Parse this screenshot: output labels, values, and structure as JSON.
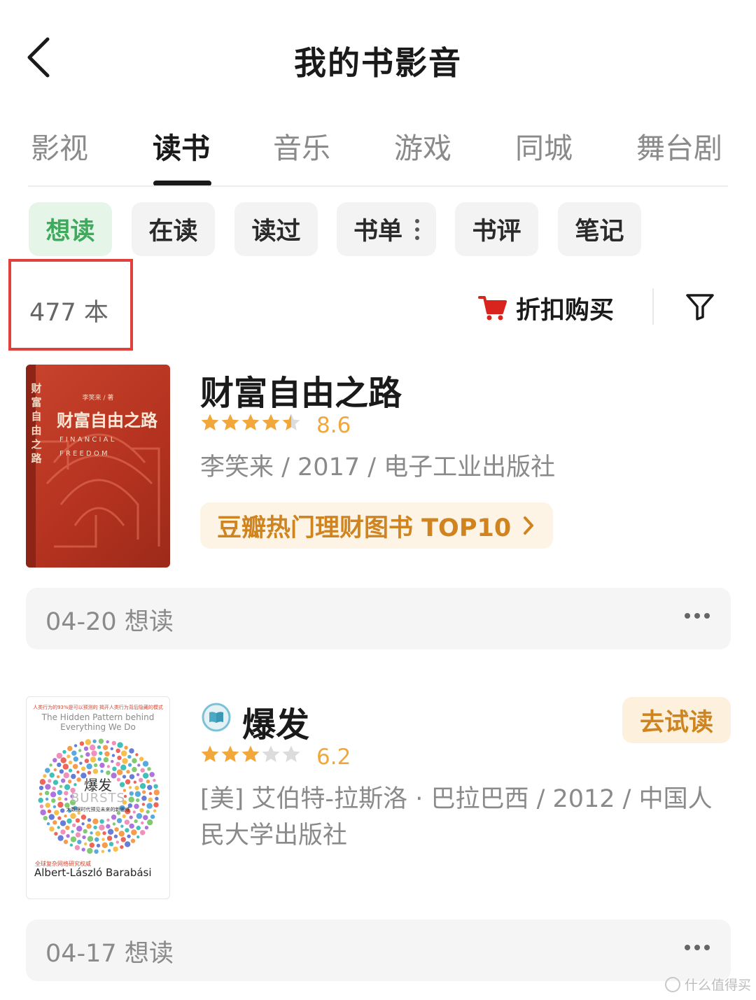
{
  "header": {
    "title": "我的书影音"
  },
  "tabs": [
    {
      "label": "影视"
    },
    {
      "label": "读书"
    },
    {
      "label": "音乐"
    },
    {
      "label": "游戏"
    },
    {
      "label": "同城"
    },
    {
      "label": "舞台剧"
    }
  ],
  "chips": [
    {
      "label": "想读"
    },
    {
      "label": "在读"
    },
    {
      "label": "读过"
    },
    {
      "label": "书单"
    },
    {
      "label": "书评"
    },
    {
      "label": "笔记"
    }
  ],
  "summary": {
    "count": "477 本",
    "buy_label": "折扣购买"
  },
  "books": [
    {
      "title": "财富自由之路",
      "stars": 4.5,
      "rating": "8.6",
      "meta": "李笑来 / 2017 / 电子工业出版社",
      "rank_tag": "豆瓣热门理财图书 TOP10",
      "cover": {
        "author_line": "李笑来 / 著",
        "title": "财富自由之路",
        "subtitle_1": "F I N A N C I A L",
        "subtitle_2": "F R E E D O M",
        "spine": "财富自由之路"
      },
      "status": "04-20 想读"
    },
    {
      "title": "爆发",
      "stars": 3,
      "rating": "6.2",
      "meta": "[美] 艾伯特-拉斯洛 · 巴拉巴西 / 2012 / 中国人民大学出版社",
      "trial_label": "去试读",
      "cover": {
        "top_line": "人类行为的93%是可以预测的   揭开人类行为背后隐藏的模式",
        "en_sub": "The Hidden Pattern behind Everything We Do",
        "title": "爆发",
        "en_title": "BURSTS",
        "sub_line": "大数据时代预见未来的新思维",
        "promo": "全球复杂网络研究权威",
        "author": "Albert-László Barabási"
      },
      "status": "04-17 想读"
    }
  ],
  "watermark": "什么值得买",
  "colors": {
    "accent_green": "#3daa5c",
    "star_orange": "#f2a73b",
    "tag_orange": "#d0841f",
    "cart_red": "#d9231d",
    "highlight_red": "#e0413a"
  }
}
